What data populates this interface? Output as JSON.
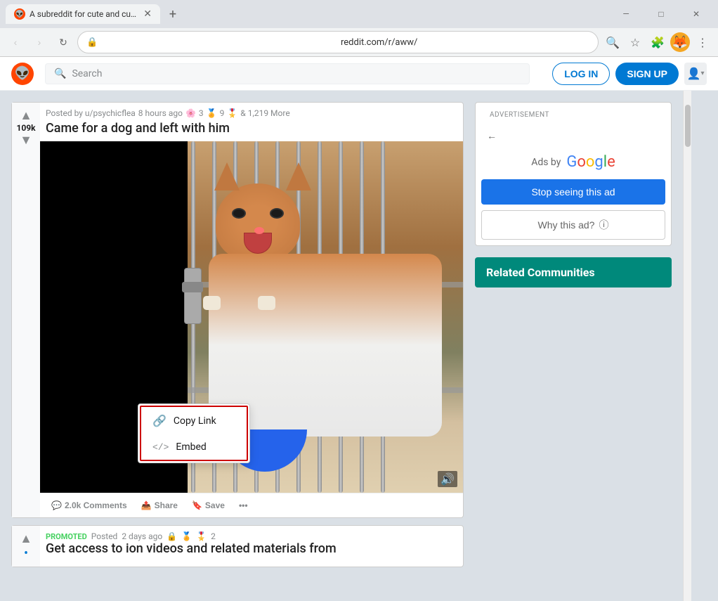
{
  "browser": {
    "tab_title": "A subreddit for cute and cuddly",
    "tab_favicon": "R",
    "url": "reddit.com/r/aww/",
    "new_tab_label": "+",
    "nav": {
      "back": "‹",
      "forward": "›",
      "refresh": "↻"
    },
    "window_controls": {
      "minimize": "—",
      "maximize": "□",
      "close": "✕"
    }
  },
  "reddit": {
    "logo": "👽",
    "search_placeholder": "Search",
    "login_label": "LOG IN",
    "signup_label": "SIGN UP"
  },
  "post": {
    "posted_by": "Posted by u/psychicflea",
    "time_ago": "8 hours ago",
    "award_count_1": "3",
    "award_count_2": "9",
    "more_awards": "& 1,219 More",
    "title": "Came for a dog and left with him",
    "vote_count": "109k",
    "comments_count": "2.0k Comments",
    "share_label": "Share",
    "save_label": "Save",
    "more_label": "…"
  },
  "share_dropdown": {
    "copy_link_label": "Copy Link",
    "embed_label": "Embed"
  },
  "promoted_post": {
    "tag": "PROMOTED",
    "posted_label": "Posted",
    "time_ago": "2 days ago",
    "awards": "2",
    "title": "Get access to",
    "title_rest": "ion videos and related materials from",
    "bullet": "•"
  },
  "advertisement": {
    "label": "ADVERTISEMENT",
    "ads_by": "Ads by",
    "google": "Google",
    "back_arrow": "←",
    "stop_seeing_label": "Stop seeing this ad",
    "why_label": "Why this ad?",
    "why_info": "ⓘ"
  },
  "sidebar": {
    "related_communities_label": "Related Communities"
  },
  "icons": {
    "search": "🔍",
    "star": "☆",
    "puzzle": "🧩",
    "avatar": "👤",
    "more": "⋮",
    "up_arrow": "▲",
    "down_arrow": "▼",
    "comment": "💬",
    "share": "📤",
    "save": "🔖",
    "link": "🔗",
    "code": "</>",
    "lock": "🔒",
    "volume": "🔊"
  }
}
